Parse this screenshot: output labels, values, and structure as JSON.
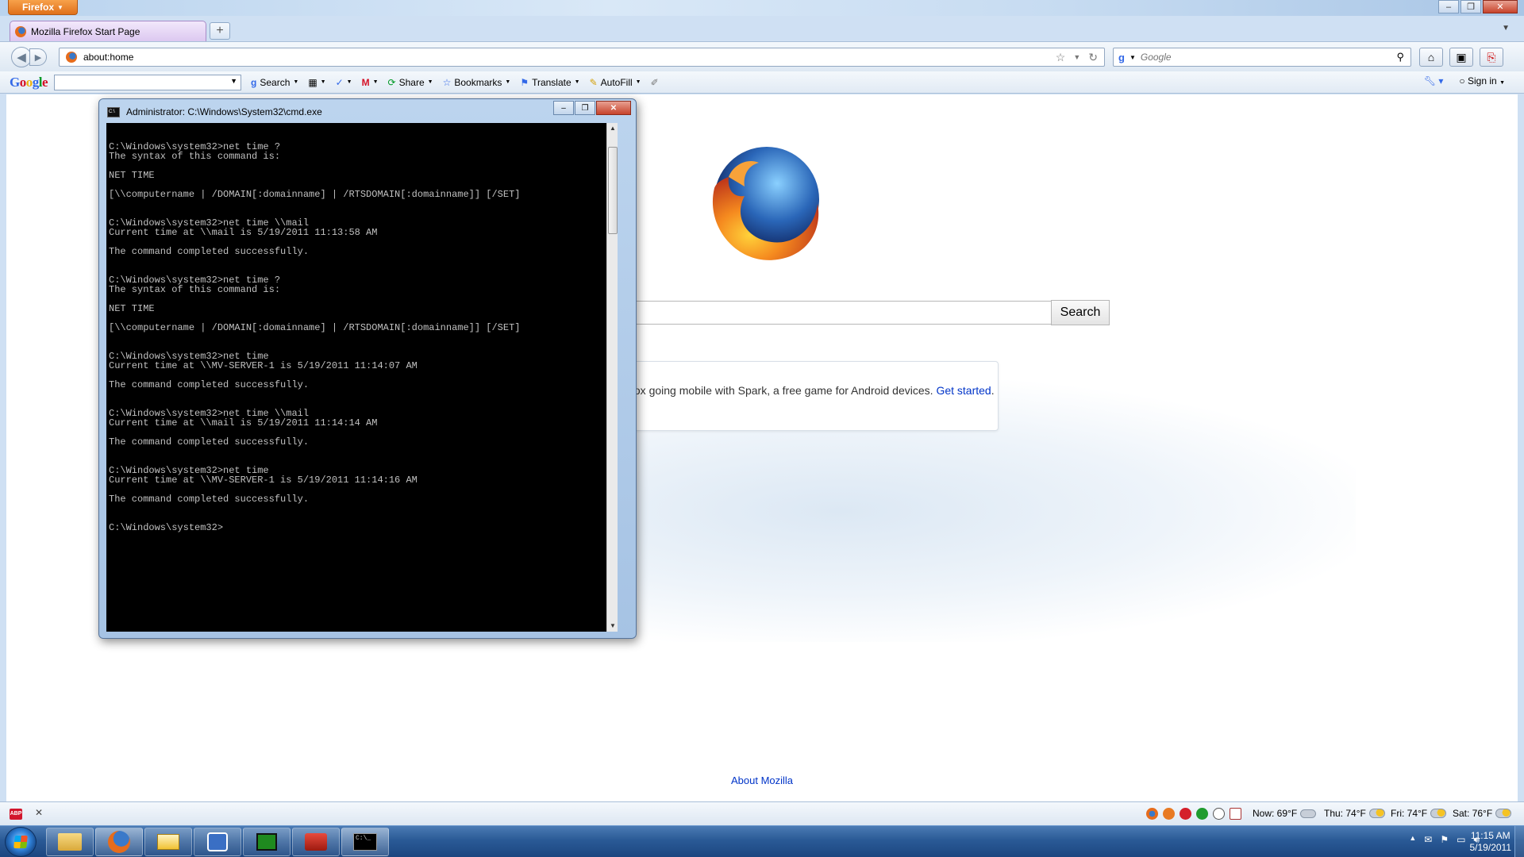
{
  "browser": {
    "app_button": "Firefox",
    "tab_title": "Mozilla Firefox Start Page",
    "url": "about:home",
    "search_placeholder": "Google"
  },
  "google_toolbar": {
    "logo": "Google",
    "search": "Search",
    "share": "Share",
    "bookmarks": "Bookmarks",
    "translate": "Translate",
    "autofill": "AutoFill",
    "sign_in": "Sign in"
  },
  "home": {
    "search_button": "Search",
    "snippet_text": "r Spark! Celebrate Firefox going mobile with Spark, a free game for Android devices.",
    "snippet_link": "Get started",
    "snippet_end": ".",
    "about": "About Mozilla"
  },
  "cmd": {
    "title": "Administrator: C:\\Windows\\System32\\cmd.exe",
    "output": "C:\\Windows\\system32>net time ?\nThe syntax of this command is:\n\nNET TIME\n\n[\\\\computername | /DOMAIN[:domainname] | /RTSDOMAIN[:domainname]] [/SET]\n\n\nC:\\Windows\\system32>net time \\\\mail\nCurrent time at \\\\mail is 5/19/2011 11:13:58 AM\n\nThe command completed successfully.\n\n\nC:\\Windows\\system32>net time ?\nThe syntax of this command is:\n\nNET TIME\n\n[\\\\computername | /DOMAIN[:domainname] | /RTSDOMAIN[:domainname]] [/SET]\n\n\nC:\\Windows\\system32>net time\nCurrent time at \\\\MV-SERVER-1 is 5/19/2011 11:14:07 AM\n\nThe command completed successfully.\n\n\nC:\\Windows\\system32>net time \\\\mail\nCurrent time at \\\\mail is 5/19/2011 11:14:14 AM\n\nThe command completed successfully.\n\n\nC:\\Windows\\system32>net time\nCurrent time at \\\\MV-SERVER-1 is 5/19/2011 11:14:16 AM\n\nThe command completed successfully.\n\n\nC:\\Windows\\system32>"
  },
  "status": {
    "abp": "ABP",
    "weather_now": "Now: 69°F",
    "weather_thu": "Thu: 74°F",
    "weather_fri": "Fri: 74°F",
    "weather_sat": "Sat: 76°F"
  },
  "taskbar": {
    "time": "11:15 AM",
    "date": "5/19/2011",
    "cmd_label": "C:\\_"
  },
  "colors": {
    "firefox_orange": "#e0701a",
    "link_blue": "#0034c8",
    "taskbar_blue": "#2a5a96"
  }
}
